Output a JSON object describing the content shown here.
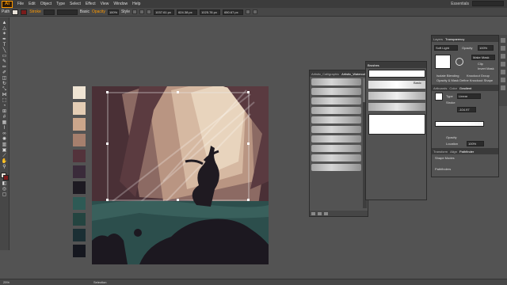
{
  "app": {
    "logo": "Ai"
  },
  "menu": [
    "File",
    "Edit",
    "Object",
    "Type",
    "Select",
    "Effect",
    "View",
    "Window",
    "Help"
  ],
  "menu_right": {
    "workspace": "Essentials"
  },
  "control_bar": {
    "selection_label": "Path",
    "stroke_label": "Stroke",
    "style_label": "Basic",
    "opacity_label": "Opacity",
    "opacity_value": "100%",
    "style2_label": "Style",
    "x_value": "1037.61 px",
    "y_value": "624.38 px",
    "w_value": "1025.78 px",
    "h_value": "650.67 px"
  },
  "swatches": [
    "#efe4d3",
    "#e4cdb4",
    "#cba68b",
    "#a67f6d",
    "#53333b",
    "#3a2b3a",
    "#1d1a22",
    "#2e5a55",
    "#244440",
    "#1b2f34",
    "#15171f"
  ],
  "brushes_panel_1": {
    "tabs": [
      "Artistic_Calligraphic",
      "Artistic_Watercolor"
    ],
    "rows": 10
  },
  "brushes_panel_2": {
    "title": "Brushes",
    "basic_label": "Basic"
  },
  "transparency_panel": {
    "tabs": [
      "Layers",
      "Transparency"
    ],
    "blend_mode": "Soft Light",
    "opacity_label": "Opacity",
    "opacity_value": "100%",
    "make_mask": "Make Mask",
    "clip": "Clip",
    "invert_mask": "Invert Mask",
    "isolate": "Isolate Blending",
    "knockout": "Knockout Group",
    "opacity_mask": "Opacity & Mask Define Knockout Shape"
  },
  "gradient_panel": {
    "tabs": [
      "Artboards",
      "Color",
      "Gradient"
    ],
    "type_label": "Type",
    "type_value": "Linear",
    "stroke_label": "Stroke",
    "angle_value": "-104.97",
    "opacity_label": "Opacity",
    "location_label": "Location",
    "location_value": "100%"
  },
  "pathfinder_panel": {
    "tabs": [
      "Transform",
      "Align",
      "Pathfinder"
    ],
    "shape_modes": "Shape Modes",
    "pathfinders": "Pathfinders"
  },
  "status": {
    "zoom": "25%",
    "tool": "Selection"
  }
}
